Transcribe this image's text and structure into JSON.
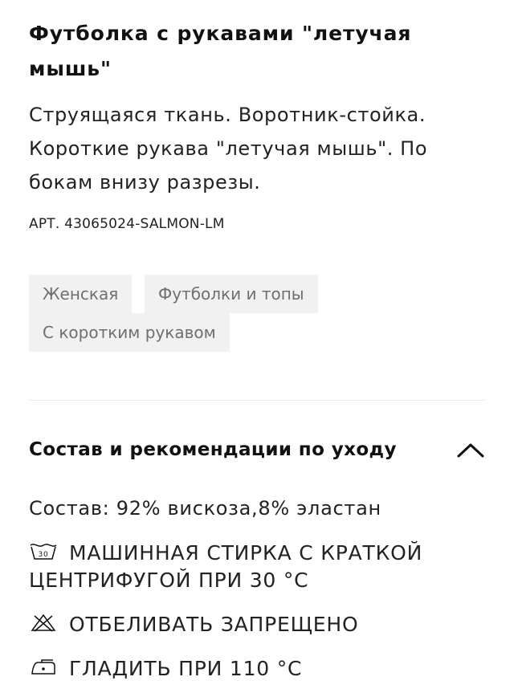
{
  "product": {
    "title": "Футболка с рукавами \"летучая мышь\"",
    "description": "Струящаяся ткань. Воротник-стойка. Короткие рукава \"летучая мышь\". По бокам внизу разрезы.",
    "article": "АРТ. 43065024-SALMON-LM"
  },
  "tags": [
    {
      "label": "Женская"
    },
    {
      "label": "Футболки и топы"
    },
    {
      "label": "С коротким рукавом"
    }
  ],
  "care_section": {
    "title": "Состав и рекомендации по уходу",
    "toggle_icon": "chevron-up-icon",
    "composition": "Состав: 92% вискоза,8% эластан",
    "items": [
      {
        "icon": "wash-30-icon",
        "icon_text": "30",
        "label": "МАШИННАЯ СТИРКА С КРАТКОЙ ЦЕНТРИФУГОЙ ПРИ 30 °C"
      },
      {
        "icon": "no-bleach-icon",
        "label": "ОТБЕЛИВАТЬ ЗАПРЕЩЕНО"
      },
      {
        "icon": "iron-110-icon",
        "label": "ГЛАДИТЬ ПРИ 110 °C"
      }
    ]
  },
  "colors": {
    "text": "#111111",
    "tag_background": "#f1f1f1",
    "tag_text": "#6f6f6f",
    "divider": "#ececec"
  }
}
